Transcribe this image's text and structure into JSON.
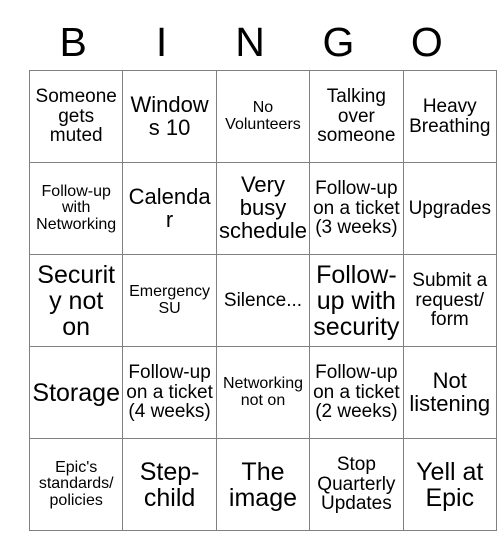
{
  "card": {
    "header_letters": [
      "B",
      "I",
      "N",
      "G",
      "O"
    ],
    "grid": {
      "columns": 5,
      "rows": 5,
      "border_color": "#808080",
      "background": "#ffffff",
      "text_color": "#000000"
    },
    "cells": [
      [
        {
          "text": "Someone gets muted",
          "size": "fs-md"
        },
        {
          "text": "Windows 10",
          "size": "fs-lg"
        },
        {
          "text": "No Volunteers",
          "size": "fs-sm"
        },
        {
          "text": "Talking over someone",
          "size": "fs-md"
        },
        {
          "text": "Heavy Breathing",
          "size": "fs-md"
        }
      ],
      [
        {
          "text": "Follow-up with Networking",
          "size": "fs-sm"
        },
        {
          "text": "Calendar",
          "size": "fs-lg"
        },
        {
          "text": "Very busy schedule",
          "size": "fs-lg"
        },
        {
          "text": "Follow-up on a ticket (3 weeks)",
          "size": "fs-md"
        },
        {
          "text": "Upgrades",
          "size": "fs-md"
        }
      ],
      [
        {
          "text": "Security not on",
          "size": "fs-xl"
        },
        {
          "text": "Emergency SU",
          "size": "fs-sm"
        },
        {
          "text": "Silence...",
          "size": "fs-md"
        },
        {
          "text": "Follow-up with security",
          "size": "fs-xl"
        },
        {
          "text": "Submit a request/ form",
          "size": "fs-md"
        }
      ],
      [
        {
          "text": "Storage",
          "size": "fs-xl"
        },
        {
          "text": "Follow-up on a ticket (4 weeks)",
          "size": "fs-md"
        },
        {
          "text": "Networking not on",
          "size": "fs-sm"
        },
        {
          "text": "Follow-up on a ticket (2 weeks)",
          "size": "fs-md"
        },
        {
          "text": "Not listening",
          "size": "fs-lg"
        }
      ],
      [
        {
          "text": "Epic's standards/ policies",
          "size": "fs-sm"
        },
        {
          "text": "Step-child",
          "size": "fs-xl"
        },
        {
          "text": "The image",
          "size": "fs-xl"
        },
        {
          "text": "Stop Quarterly Updates",
          "size": "fs-md"
        },
        {
          "text": "Yell at Epic",
          "size": "fs-xl"
        }
      ]
    ]
  }
}
